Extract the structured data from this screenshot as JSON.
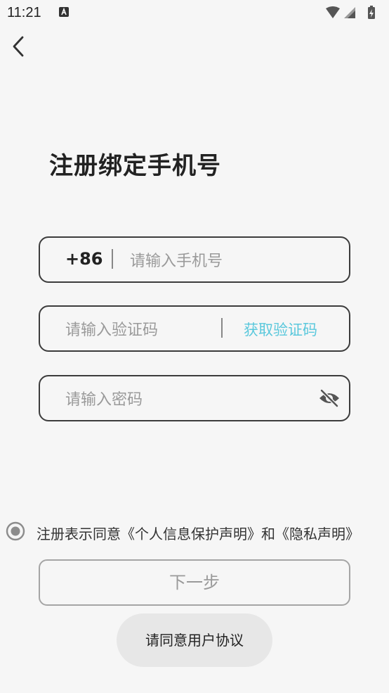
{
  "status_bar": {
    "time": "11:21"
  },
  "page": {
    "title": "注册绑定手机号"
  },
  "phone_field": {
    "prefix": "+86",
    "placeholder": "请输入手机号"
  },
  "code_field": {
    "placeholder": "请输入验证码",
    "get_code_label": "获取验证码"
  },
  "password_field": {
    "placeholder": "请输入密码"
  },
  "agreement": {
    "text": "注册表示同意《个人信息保护声明》和《隐私声明》"
  },
  "next_button": {
    "label": "下一步"
  },
  "toast": {
    "text": "请同意用户协议"
  },
  "colors": {
    "accent": "#5ac8dc",
    "border": "#3c3c3c",
    "disabled": "#a5a5a5"
  }
}
